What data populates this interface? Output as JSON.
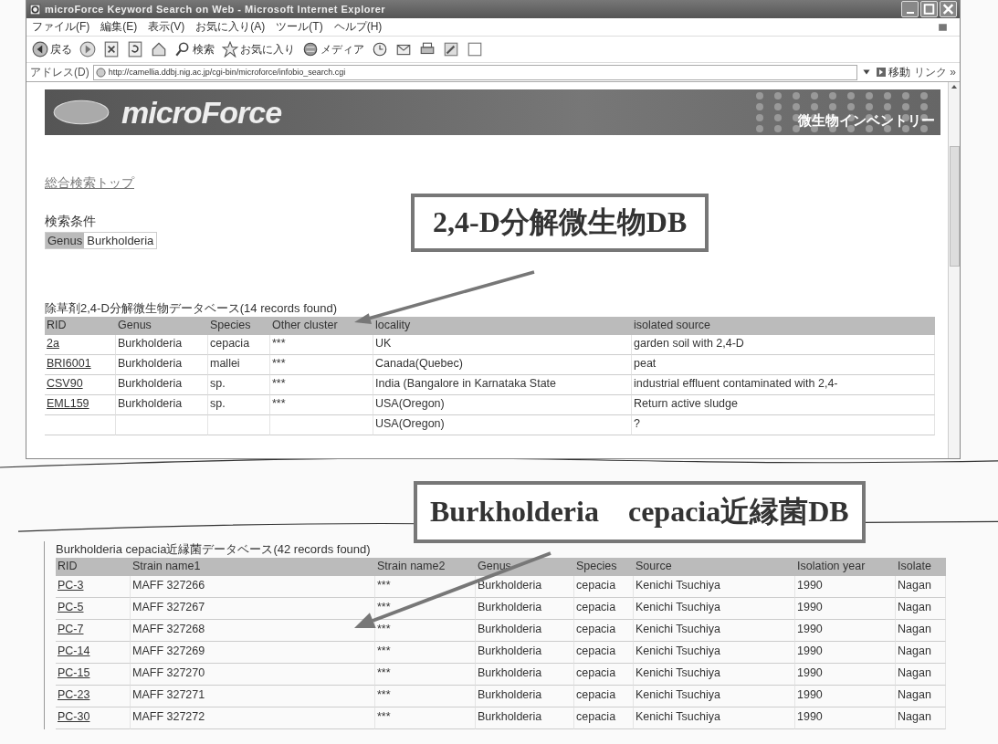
{
  "window": {
    "title": "microForce Keyword Search on Web - Microsoft Internet Explorer",
    "menu": [
      "ファイル(F)",
      "編集(E)",
      "表示(V)",
      "お気に入り(A)",
      "ツール(T)",
      "ヘルプ(H)"
    ],
    "toolbar": [
      {
        "kind": "back",
        "label": "戻る"
      },
      {
        "kind": "forward"
      },
      {
        "kind": "stop"
      },
      {
        "kind": "refresh"
      },
      {
        "kind": "home"
      },
      {
        "kind": "search",
        "label": "検索"
      },
      {
        "kind": "favorites",
        "label": "お気に入り"
      },
      {
        "kind": "media",
        "label": "メディア"
      },
      {
        "kind": "history"
      },
      {
        "kind": "mail"
      },
      {
        "kind": "print"
      },
      {
        "kind": "edit"
      },
      {
        "kind": "discuss"
      }
    ],
    "address": {
      "label": "アドレス(D)",
      "url": "http://camellia.ddbj.nig.ac.jp/cgi-bin/microforce/infobio_search.cgi",
      "go": "移動",
      "links": "リンク »"
    }
  },
  "page": {
    "banner": {
      "logo": "microForce",
      "tagline": "微生物インベントリー"
    },
    "top_link": "総合検索トップ",
    "condition_label": "検索条件",
    "condition": {
      "field": "Genus",
      "value": "Burkholderia"
    },
    "table": {
      "caption": "除草剤2,4-D分解微生物データベース(14 records found)",
      "columns": [
        "RID",
        "Genus",
        "Species",
        "Other cluster",
        "locality",
        "isolated source"
      ],
      "rows": [
        [
          "2a",
          "Burkholderia",
          "cepacia",
          "***",
          "UK",
          "garden soil with 2,4-D"
        ],
        [
          "BRI6001",
          "Burkholderia",
          "mallei",
          "***",
          "Canada(Quebec)",
          "peat"
        ],
        [
          "CSV90",
          "Burkholderia",
          "sp.",
          "***",
          "India (Bangalore in Karnataka State",
          "industrial effluent contaminated with 2,4-"
        ],
        [
          "EML159",
          "Burkholderia",
          "sp.",
          "***",
          "USA(Oregon)",
          "Return active sludge"
        ],
        [
          null,
          null,
          null,
          null,
          "USA(Oregon)",
          "?"
        ]
      ]
    }
  },
  "fragment": {
    "table": {
      "caption": "Burkholderia cepacia近縁菌データベース(42 records found)",
      "columns": [
        "RID",
        "Strain name1",
        "Strain name2",
        "Genus",
        "Species",
        "Source",
        "Isolation year",
        "Isolate"
      ],
      "rows": [
        [
          "PC-3",
          "MAFF 327266",
          "***",
          "Burkholderia",
          "cepacia",
          "Kenichi Tsuchiya",
          "1990",
          "Nagan"
        ],
        [
          "PC-5",
          "MAFF 327267",
          "***",
          "Burkholderia",
          "cepacia",
          "Kenichi Tsuchiya",
          "1990",
          "Nagan"
        ],
        [
          "PC-7",
          "MAFF 327268",
          "***",
          "Burkholderia",
          "cepacia",
          "Kenichi Tsuchiya",
          "1990",
          "Nagan"
        ],
        [
          "PC-14",
          "MAFF 327269",
          "***",
          "Burkholderia",
          "cepacia",
          "Kenichi Tsuchiya",
          "1990",
          "Nagan"
        ],
        [
          "PC-15",
          "MAFF 327270",
          "***",
          "Burkholderia",
          "cepacia",
          "Kenichi Tsuchiya",
          "1990",
          "Nagan"
        ],
        [
          "PC-23",
          "MAFF 327271",
          "***",
          "Burkholderia",
          "cepacia",
          "Kenichi Tsuchiya",
          "1990",
          "Nagan"
        ],
        [
          "PC-30",
          "MAFF 327272",
          "***",
          "Burkholderia",
          "cepacia",
          "Kenichi Tsuchiya",
          "1990",
          "Nagan"
        ]
      ]
    }
  },
  "callouts": [
    {
      "text": "2,4-D分解微生物DB"
    },
    {
      "text": "Burkholderia　cepacia近縁菌DB"
    }
  ]
}
